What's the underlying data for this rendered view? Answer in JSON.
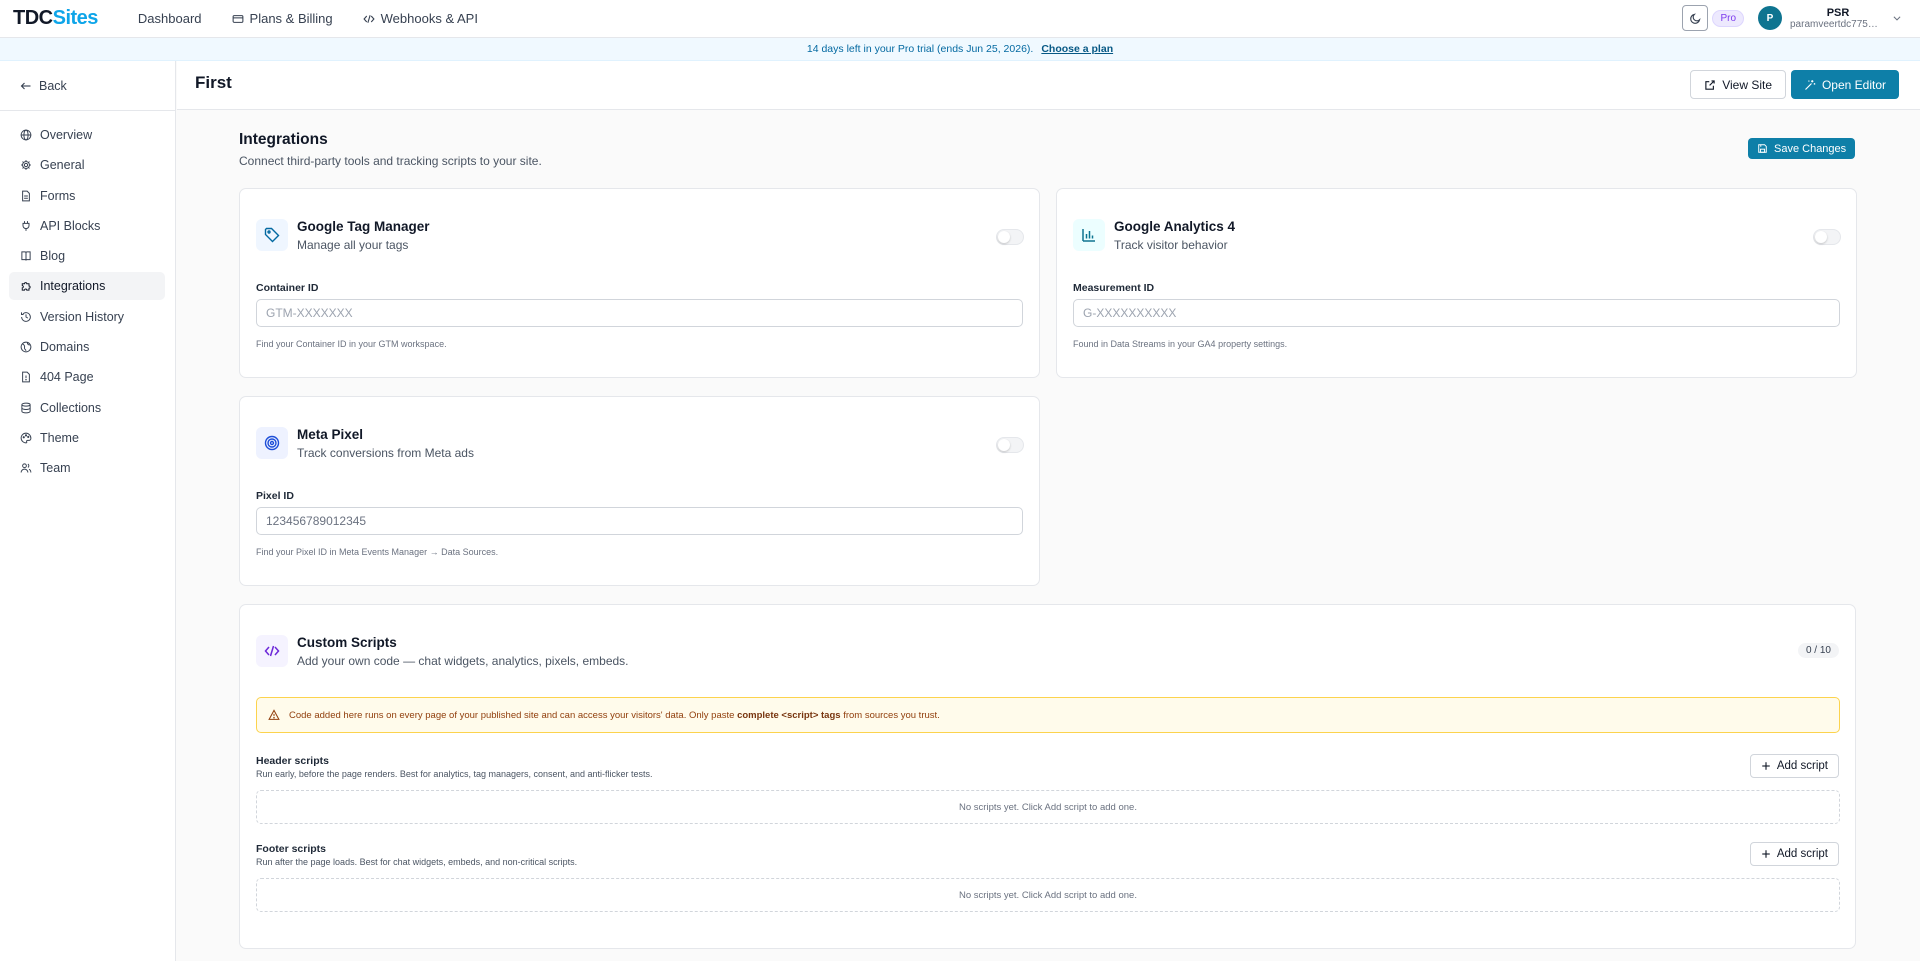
{
  "brand": {
    "part1": "TDC",
    "part2": "Sites"
  },
  "topnav": [
    {
      "label": "Dashboard",
      "icon": ""
    },
    {
      "label": "Plans & Billing",
      "icon": "credit-card-icon"
    },
    {
      "label": "Webhooks & API",
      "icon": "code-icon"
    }
  ],
  "user": {
    "badge": "Pro",
    "initial": "P",
    "name": "PSR",
    "email": "paramveertdc775@gm..."
  },
  "banner": {
    "text": "14 days left in your Pro trial (ends Jun 25, 2026).",
    "cta": "Choose a plan"
  },
  "sidebar": {
    "back_label": "Back",
    "items": [
      {
        "label": "Overview",
        "icon": "globe-icon",
        "active": false
      },
      {
        "label": "General",
        "icon": "gear-icon",
        "active": false
      },
      {
        "label": "Forms",
        "icon": "document-icon",
        "active": false
      },
      {
        "label": "API Blocks",
        "icon": "plug-icon",
        "active": false
      },
      {
        "label": "Blog",
        "icon": "book-icon",
        "active": false
      },
      {
        "label": "Integrations",
        "icon": "puzzle-icon",
        "active": true
      },
      {
        "label": "Version History",
        "icon": "history-icon",
        "active": false
      },
      {
        "label": "Domains",
        "icon": "globe-icon",
        "active": false
      },
      {
        "label": "404 Page",
        "icon": "file-alert-icon",
        "active": false
      },
      {
        "label": "Collections",
        "icon": "database-icon",
        "active": false
      },
      {
        "label": "Theme",
        "icon": "palette-icon",
        "active": false
      },
      {
        "label": "Team",
        "icon": "users-icon",
        "active": false
      }
    ]
  },
  "page": {
    "title": "First",
    "view_site": "View Site",
    "open_editor": "Open Editor"
  },
  "integrations": {
    "title": "Integrations",
    "subtitle": "Connect third-party tools and tracking scripts to your site.",
    "save_label": "Save Changes",
    "gtm": {
      "title": "Google Tag Manager",
      "subtitle": "Manage all your tags",
      "field_label": "Container ID",
      "placeholder": "GTM-XXXXXXX",
      "value": "",
      "help": "Find your Container ID in your GTM workspace."
    },
    "ga4": {
      "title": "Google Analytics 4",
      "subtitle": "Track visitor behavior",
      "field_label": "Measurement ID",
      "placeholder": "G-XXXXXXXXXX",
      "value": "",
      "help": "Found in Data Streams in your GA4 property settings."
    },
    "meta": {
      "title": "Meta Pixel",
      "subtitle": "Track conversions from Meta ads",
      "field_label": "Pixel ID",
      "placeholder": "",
      "value": "123456789012345",
      "help": "Find your Pixel ID in Meta Events Manager → Data Sources."
    }
  },
  "custom_scripts": {
    "title": "Custom Scripts",
    "subtitle": "Add your own code — chat widgets, analytics, pixels, embeds.",
    "count": "0 / 10",
    "warning_pre": "Code added here runs on every page of your published site and can access your visitors' data. Only paste",
    "warning_bold": "complete <script> tags",
    "warning_post": "from sources you trust.",
    "header": {
      "title": "Header scripts",
      "desc": "Run early, before the page renders. Best for analytics, tag managers, consent, and anti-flicker tests.",
      "add_label": "Add script",
      "empty": "No scripts yet. Click Add script to add one."
    },
    "footer": {
      "title": "Footer scripts",
      "desc": "Run after the page loads. Best for chat widgets, embeds, and non-critical scripts.",
      "add_label": "Add script",
      "empty": "No scripts yet. Click Add script to add one."
    }
  },
  "colors": {
    "accent": "#0e7fa8",
    "brand_sites": "#0ea5e9",
    "warning_bg": "#fffbeb",
    "warning_border": "#fcd34d"
  }
}
